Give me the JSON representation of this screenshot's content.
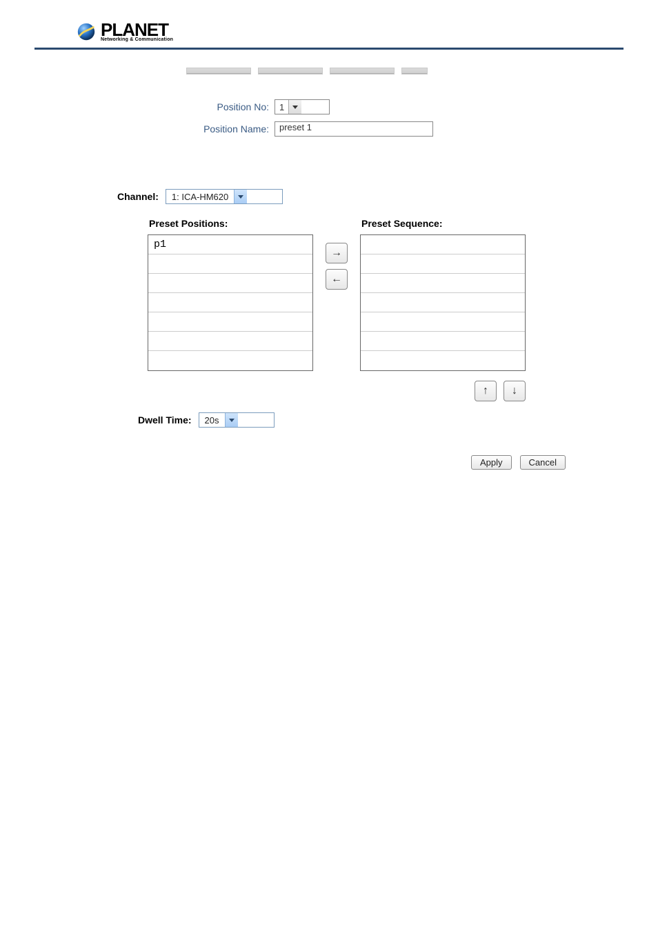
{
  "logo": {
    "name": "PLANET",
    "subtitle": "Networking & Communication"
  },
  "fig1": {
    "labels": {
      "position_no": "Position No:",
      "position_name": "Position Name:"
    },
    "position_no_value": "1",
    "position_name_value": "preset 1",
    "caption": ""
  },
  "body": {
    "heading": "",
    "para": ""
  },
  "fig2": {
    "channel_label": "Channel:",
    "channel_value": "1: ICA-HM620",
    "positions_title": "Preset Positions:",
    "sequence_title": "Preset Sequence:",
    "positions": [
      "p1",
      "",
      "",
      "",
      "",
      "",
      ""
    ],
    "sequence": [
      "",
      "",
      "",
      "",
      "",
      "",
      ""
    ],
    "dwell_label": "Dwell Time:",
    "dwell_value": "20s",
    "apply_label": "Apply",
    "cancel_label": "Cancel"
  },
  "desc": [
    {
      "term": "",
      "def": ""
    },
    {
      "term": "",
      "def": ""
    },
    {
      "term": "",
      "def": ""
    }
  ],
  "footer": ""
}
